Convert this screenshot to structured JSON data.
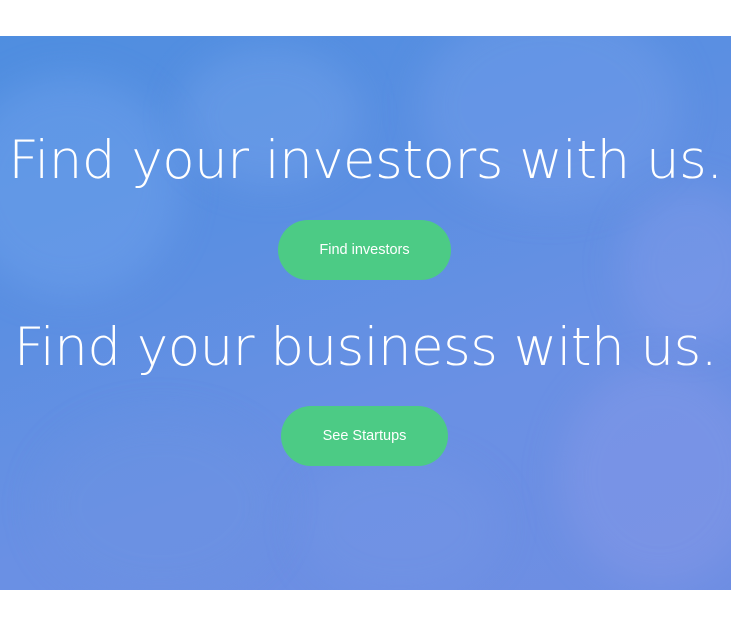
{
  "hero": {
    "investors_headline": "Find your investors with us.",
    "investors_button_label": "Find investors",
    "business_headline": "Find your business with us.",
    "business_button_label": "See Startups",
    "colors": {
      "background_start": "#4f8ee0",
      "background_end": "#6e8ee3",
      "button": "#4ccb85",
      "text": "#ffffff"
    }
  }
}
